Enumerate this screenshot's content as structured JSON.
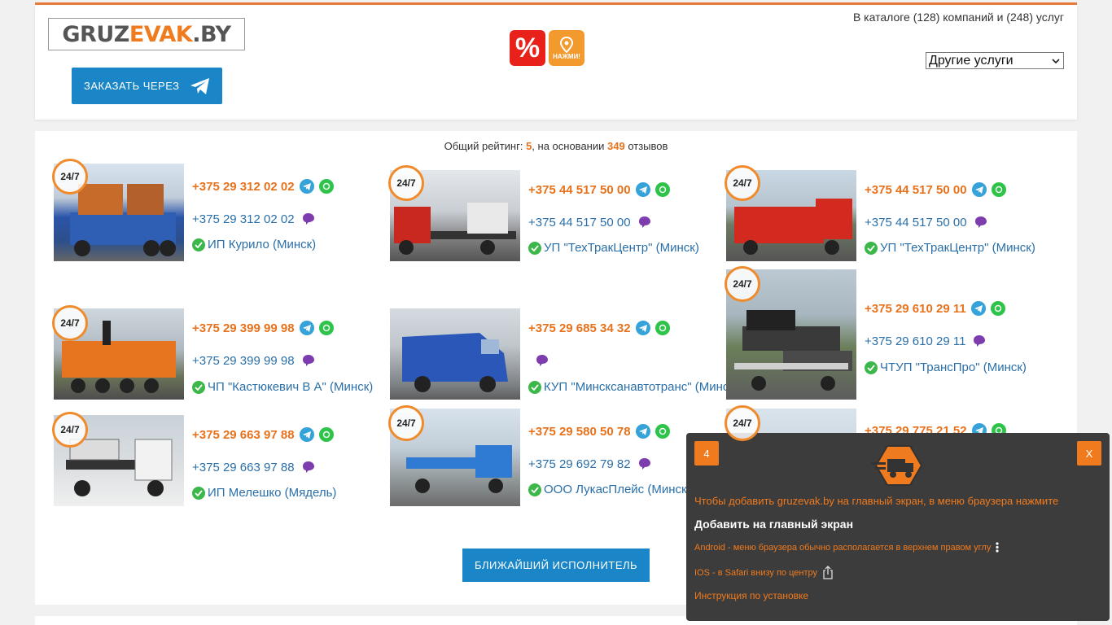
{
  "header": {
    "logo_part1": "GRUZ",
    "logo_part2": "EVAK",
    "logo_part3": ".BY",
    "order_button": "ЗАКАЗАТЬ ЧЕРЕЗ",
    "promo_discount_symbol": "%",
    "promo_map_label": "НАЖМИ!",
    "catalog_text": "В каталоге (128) компаний и (248) услуг",
    "services_select": "Другие услуги"
  },
  "rating": {
    "prefix": "Общий рейтинг: ",
    "value": "5",
    "middle": ", на основании ",
    "count": "349",
    "suffix": " отзывов"
  },
  "badge_text": "24/7",
  "cards": [
    {
      "phone1": "+375 29 312 02 02",
      "phone2": "+375 29 312 02 02",
      "company": "ИП Курило (Минск)"
    },
    {
      "phone1": "+375 44 517 50 00",
      "phone2": "+375 44 517 50 00",
      "company": "УП \"ТехТракЦентр\" (Минск)"
    },
    {
      "phone1": "+375 44 517 50 00",
      "phone2": "+375 44 517 50 00",
      "company": "УП \"ТехТракЦентр\" (Минск)"
    },
    {
      "phone1": "+375 29 399 99 98",
      "phone2": "+375 29 399 99 98",
      "company": "ЧП \"Кастюкевич В А\" (Минск)"
    },
    {
      "phone1": "+375 29 685 34 32",
      "phone2": "",
      "company": "КУП \"Минсксанавтотранс\" (Минск)"
    },
    {
      "phone1": "+375 29 610 29 11",
      "phone2": "+375 29 610 29 11",
      "company": "ЧТУП \"ТрансПро\" (Минск)"
    },
    {
      "phone1": "+375 29 663 97 88",
      "phone2": "+375 29 663 97 88",
      "company": "ИП Мелешко (Мядель)"
    },
    {
      "phone1": "+375 29 580 50 78",
      "phone2": "+375 29 692 79 82",
      "company": "ООО ЛукасПлейс (Минск)"
    },
    {
      "phone1": "+375 29 775 21 52",
      "phone2": "",
      "company": ""
    }
  ],
  "nearest_button": "БЛИЖАЙШИЙ ИСПОЛНИТЕЛЬ",
  "popup": {
    "count": "4",
    "close": "X",
    "text1": "Чтобы добавить gruzevak.by на главный экран, в меню браузера нажмите",
    "title": "Добавить на главный экран",
    "android": "Android - меню браузера обычно располагается в верхнем правом углу",
    "ios": "IOS - в Safari внизу по центру",
    "instruction": "Инструкция по установке"
  },
  "colors": {
    "accent": "#f07a1e",
    "link": "#2a6fa8",
    "button": "#1a86c8",
    "popup_bg": "#3c3c3c"
  }
}
